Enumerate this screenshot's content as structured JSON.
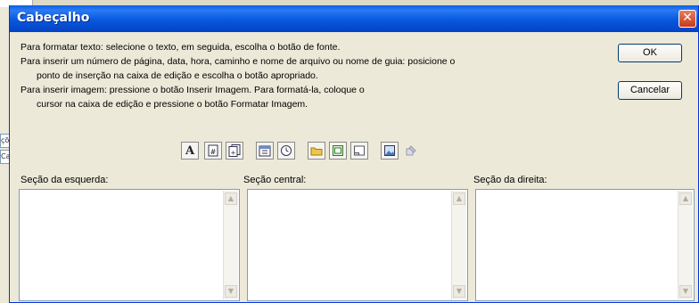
{
  "window": {
    "title": "Cabeçalho",
    "close_glyph": "✕"
  },
  "background": {
    "cells": [
      "çõ",
      "Ca"
    ]
  },
  "instructions": [
    "Para formatar texto: selecione o texto, em seguida, escolha o botão de fonte.",
    "Para inserir um número de página, data, hora, caminho e nome de arquivo ou nome de guia: posicione o",
    "ponto de inserção na caixa de edição e escolha o botão apropriado.",
    "Para inserir imagem: pressione o botão Inserir Imagem. Para formatá-la, coloque o",
    "cursor na caixa de edição e pressione o botão Formatar Imagem."
  ],
  "buttons": {
    "ok": "OK",
    "cancel": "Cancelar"
  },
  "toolbar": {
    "font_glyph": "A",
    "items": [
      "font-icon",
      "page-number-icon",
      "total-pages-icon",
      "date-icon",
      "time-icon",
      "file-path-icon",
      "file-name-icon",
      "sheet-name-icon",
      "insert-picture-icon",
      "format-picture-icon"
    ]
  },
  "sections": {
    "left": "Seção da esquerda:",
    "center": "Seção central:",
    "right": "Seção da direita:"
  },
  "colors": {
    "title_bar": "#0858de",
    "dialog_face": "#ece9d8",
    "close": "#c8391a",
    "field_border": "#7f9db9"
  }
}
